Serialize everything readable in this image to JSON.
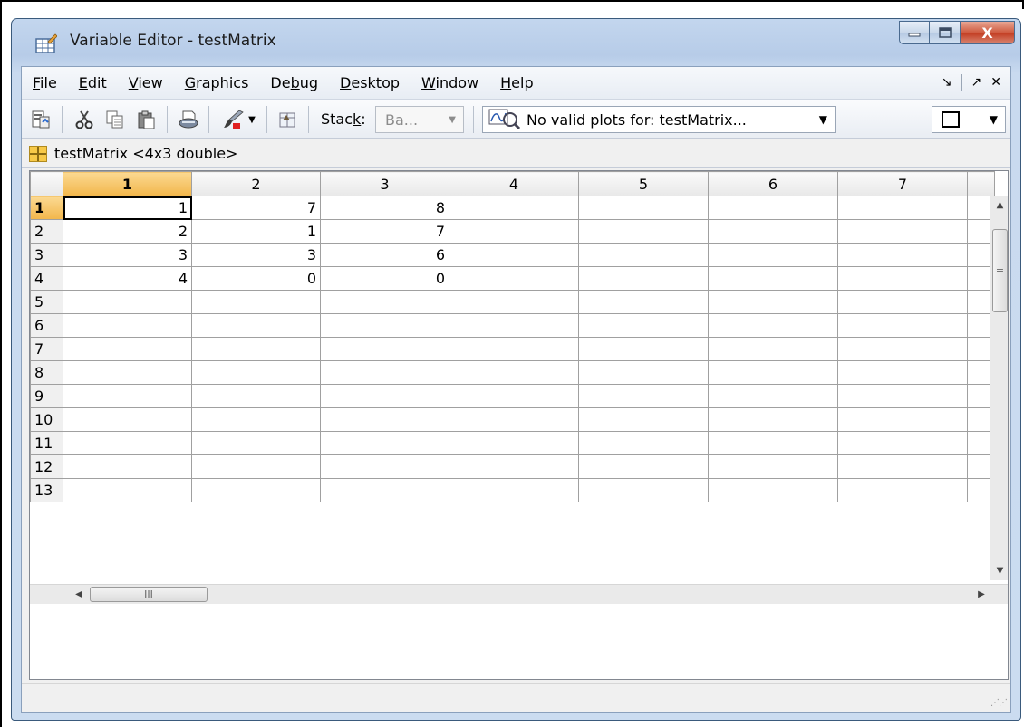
{
  "window": {
    "title": "Variable Editor - testMatrix",
    "close_label": "X"
  },
  "menu": {
    "items": [
      {
        "label": "File",
        "mnemonic": "F",
        "rest": "ile"
      },
      {
        "label": "Edit",
        "mnemonic": "E",
        "rest": "dit"
      },
      {
        "label": "View",
        "mnemonic": "V",
        "rest": "iew"
      },
      {
        "label": "Graphics",
        "mnemonic": "G",
        "rest": "raphics"
      },
      {
        "label": "Debug",
        "pre": "De",
        "mnemonic": "b",
        "rest": "ug"
      },
      {
        "label": "Desktop",
        "mnemonic": "D",
        "rest": "esktop"
      },
      {
        "label": "Window",
        "mnemonic": "W",
        "rest": "indow"
      },
      {
        "label": "Help",
        "mnemonic": "H",
        "rest": "elp"
      }
    ],
    "undock_glyph": "↘",
    "dock_glyph": "↗",
    "close_glyph": "✕"
  },
  "toolbar": {
    "stack_label_pre": "Stac",
    "stack_label_mnemonic": "k",
    "stack_label_post": ":",
    "stack_value": "Ba...",
    "plots_value": "No valid plots for: testMatrix...",
    "icons": [
      "import-data-icon",
      "cut-icon",
      "copy-icon",
      "paste-icon",
      "print-icon",
      "brush-icon",
      "new-variable-icon",
      "plot-icon"
    ]
  },
  "variable": {
    "header": "testMatrix <4x3 double>"
  },
  "grid": {
    "columns": [
      "1",
      "2",
      "3",
      "4",
      "5",
      "6",
      "7"
    ],
    "rows": [
      {
        "label": "1",
        "cells": [
          "1",
          "7",
          "8",
          "",
          "",
          "",
          ""
        ]
      },
      {
        "label": "2",
        "cells": [
          "2",
          "1",
          "7",
          "",
          "",
          "",
          ""
        ]
      },
      {
        "label": "3",
        "cells": [
          "3",
          "3",
          "6",
          "",
          "",
          "",
          ""
        ]
      },
      {
        "label": "4",
        "cells": [
          "4",
          "0",
          "0",
          "",
          "",
          "",
          ""
        ]
      },
      {
        "label": "5",
        "cells": [
          "",
          "",
          "",
          "",
          "",
          "",
          ""
        ]
      },
      {
        "label": "6",
        "cells": [
          "",
          "",
          "",
          "",
          "",
          "",
          ""
        ]
      },
      {
        "label": "7",
        "cells": [
          "",
          "",
          "",
          "",
          "",
          "",
          ""
        ]
      },
      {
        "label": "8",
        "cells": [
          "",
          "",
          "",
          "",
          "",
          "",
          ""
        ]
      },
      {
        "label": "9",
        "cells": [
          "",
          "",
          "",
          "",
          "",
          "",
          ""
        ]
      },
      {
        "label": "10",
        "cells": [
          "",
          "",
          "",
          "",
          "",
          "",
          ""
        ]
      },
      {
        "label": "11",
        "cells": [
          "",
          "",
          "",
          "",
          "",
          "",
          ""
        ]
      },
      {
        "label": "12",
        "cells": [
          "",
          "",
          "",
          "",
          "",
          "",
          ""
        ]
      },
      {
        "label": "13",
        "cells": [
          "",
          "",
          "",
          "",
          "",
          "",
          ""
        ]
      }
    ],
    "selected_row": "1",
    "selected_col": "1"
  },
  "scroll": {
    "thumb_grip_v": "≡",
    "thumb_grip_h": "III"
  },
  "colors": {
    "active_header": "#f2b64b",
    "title_bar": "#b7cce8",
    "close_button": "#c23a1e"
  }
}
